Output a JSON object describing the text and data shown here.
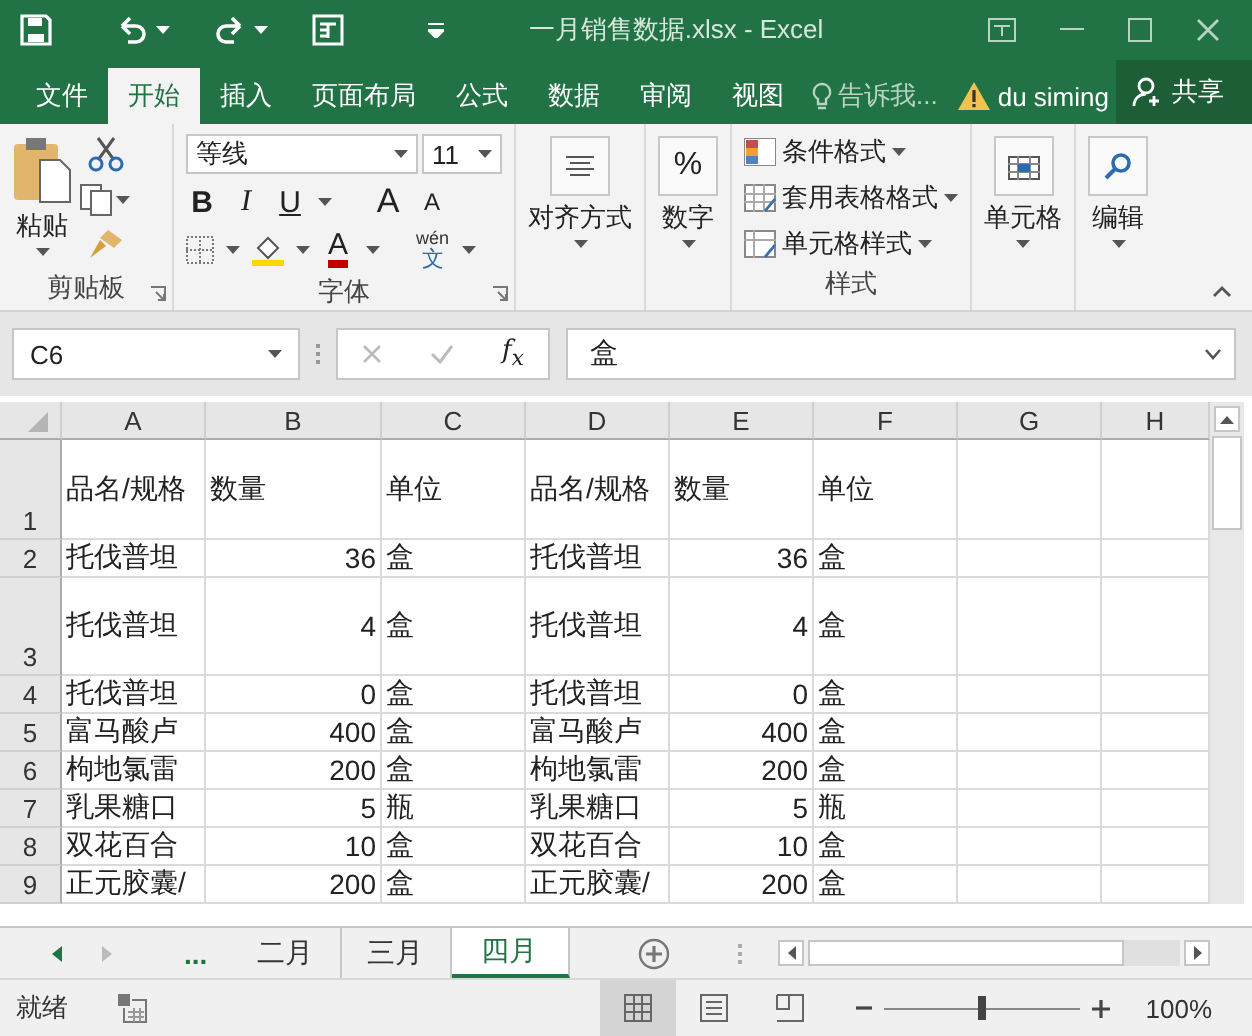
{
  "window": {
    "title": "一月销售数据.xlsx - Excel"
  },
  "ribbon_tabs": [
    {
      "label": "文件",
      "selected": false
    },
    {
      "label": "开始",
      "selected": true
    },
    {
      "label": "插入",
      "selected": false
    },
    {
      "label": "页面布局",
      "selected": false
    },
    {
      "label": "公式",
      "selected": false
    },
    {
      "label": "数据",
      "selected": false
    },
    {
      "label": "审阅",
      "selected": false
    },
    {
      "label": "视图",
      "selected": false
    }
  ],
  "tell_me": {
    "placeholder": "告诉我..."
  },
  "user": "du siming",
  "share": "共享",
  "clipboard": {
    "paste": "粘贴",
    "group": "剪贴板"
  },
  "font": {
    "name": "等线",
    "size": "11",
    "group": "字体",
    "buttons": [
      {
        "kind": "bold",
        "label": "B"
      },
      {
        "kind": "italic",
        "label": "I"
      },
      {
        "kind": "underline",
        "label": "U"
      },
      {
        "kind": "grow",
        "label": "A"
      },
      {
        "kind": "shrink",
        "label": "A"
      },
      {
        "kind": "color",
        "label": "A"
      },
      {
        "kind": "phonetic",
        "label": "wén",
        "sub": "文"
      }
    ]
  },
  "alignment": "对齐方式",
  "number": {
    "label": "数字",
    "symbol": "%"
  },
  "styles": {
    "items": [
      "条件格式",
      "套用表格格式",
      "单元格样式"
    ],
    "group": "样式"
  },
  "cells": "单元格",
  "editing": "编辑",
  "formula_bar": {
    "name_box": "C6",
    "fx": "f$_{x}$",
    "value": "盒"
  },
  "columns": [
    "A",
    "B",
    "C",
    "D",
    "E",
    "F",
    "G",
    "H"
  ],
  "rows": [
    {
      "num": "1",
      "cells": [
        "品名/规格",
        "数量",
        "单位",
        "品名/规格",
        "数量",
        "单位"
      ]
    },
    {
      "num": "2",
      "cells": [
        "托伐普坦",
        "36",
        "盒",
        "托伐普坦",
        "36",
        "盒"
      ]
    },
    {
      "num": "3",
      "cells": [
        "托伐普坦",
        "4",
        "盒",
        "托伐普坦",
        "4",
        "盒"
      ]
    },
    {
      "num": "4",
      "cells": [
        "托伐普坦",
        "0",
        "盒",
        "托伐普坦",
        "0",
        "盒"
      ]
    },
    {
      "num": "5",
      "cells": [
        "富马酸卢",
        "400",
        "盒",
        "富马酸卢",
        "400",
        "盒"
      ]
    },
    {
      "num": "6",
      "cells": [
        "枸地氯雷",
        "200",
        "盒",
        "枸地氯雷",
        "200",
        "盒"
      ]
    },
    {
      "num": "7",
      "cells": [
        "乳果糖口",
        "5",
        "瓶",
        "乳果糖口",
        "5",
        "瓶"
      ]
    },
    {
      "num": "8",
      "cells": [
        "双花百合",
        "10",
        "盒",
        "双花百合",
        "10",
        "盒"
      ]
    },
    {
      "num": "9",
      "cells": [
        "正元胶囊/",
        "200",
        "盒",
        "正元胶囊/",
        "200",
        "盒"
      ]
    }
  ],
  "sheet_tabs": [
    {
      "label": "...",
      "kind": "more",
      "selected": false
    },
    {
      "label": "二月",
      "kind": "sheet",
      "selected": false
    },
    {
      "label": "三月",
      "kind": "sheet",
      "selected": false
    },
    {
      "label": "四月",
      "kind": "sheet",
      "selected": true
    }
  ],
  "status": {
    "text": "就绪",
    "level": 0.5,
    "zoom": "100%"
  },
  "views": [
    {
      "kind": "normal",
      "selected": true
    },
    {
      "kind": "layout",
      "selected": false
    },
    {
      "kind": "break",
      "selected": false
    }
  ]
}
